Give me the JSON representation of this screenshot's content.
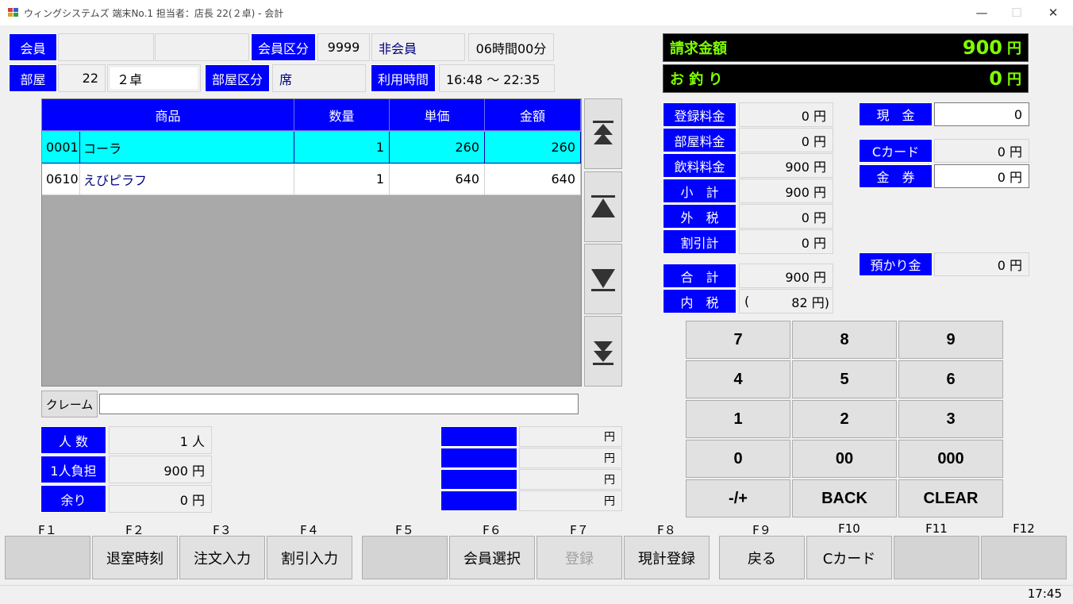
{
  "window": {
    "title": "ウィングシステムズ 端末No.1 担当者：店長 22(２卓) - 会計",
    "minimize": "—",
    "maximize": "☐",
    "close": "✕"
  },
  "member": {
    "label": "会員",
    "value1": "",
    "value2": "",
    "type_label": "会員区分",
    "type_code": "9999",
    "type_name": "非会員",
    "time_allowance": "06時間00分"
  },
  "room": {
    "label": "部屋",
    "number": "22",
    "name": "２卓",
    "type_label": "部屋区分",
    "type_name": "席",
    "usage_label": "利用時間",
    "usage_time": "16:48 ～ 22:35"
  },
  "grid": {
    "headers": [
      "商品",
      "数量",
      "単価",
      "金額"
    ],
    "rows": [
      {
        "code": "0001",
        "name": "コーラ",
        "qty": "1",
        "price": "260",
        "amount": "260",
        "selected": true
      },
      {
        "code": "0610",
        "name": "えびピラフ",
        "qty": "1",
        "price": "640",
        "amount": "640",
        "selected": false
      }
    ]
  },
  "claim": {
    "button": "クレーム",
    "value": ""
  },
  "people": {
    "count_label": "人 数",
    "count_value": "1 人",
    "per_person_label": "1人負担",
    "per_person_value": "900 円",
    "remainder_label": "余り",
    "remainder_value": "0 円"
  },
  "extra_lines": [
    {
      "label": "",
      "value": "円"
    },
    {
      "label": "",
      "value": "円"
    },
    {
      "label": "",
      "value": "円"
    },
    {
      "label": "",
      "value": "円"
    }
  ],
  "totals": {
    "billing_label": "請求金額",
    "billing_value": "900",
    "billing_unit": "円",
    "change_label": "お 釣 り",
    "change_value": "0",
    "change_unit": "円"
  },
  "breakdown": [
    {
      "label": "登録料金",
      "value": "0 円"
    },
    {
      "label": "部屋料金",
      "value": "0 円"
    },
    {
      "label": "飲料料金",
      "value": "900 円"
    },
    {
      "label": "小　計",
      "value": "900 円"
    },
    {
      "label": "外　税",
      "value": "0 円"
    },
    {
      "label": "割引計",
      "value": "0 円"
    }
  ],
  "sum": {
    "total_label": "合　計",
    "total_value": "900 円",
    "tax_label": "内　税",
    "tax_open": "(",
    "tax_value": "82 円)"
  },
  "payment": {
    "cash_label": "現　金",
    "cash_value": "0",
    "ccard_label": "Cカード",
    "ccard_value": "0 円",
    "voucher_label": "金　券",
    "voucher_value": "0 円",
    "deposit_label": "預かり金",
    "deposit_value": "0 円"
  },
  "keypad": [
    "7",
    "8",
    "9",
    "4",
    "5",
    "6",
    "1",
    "2",
    "3",
    "0",
    "00",
    "000",
    "-/+",
    "BACK",
    "CLEAR"
  ],
  "fkeys": [
    {
      "key": "F１",
      "label": ""
    },
    {
      "key": "F２",
      "label": "退室時刻"
    },
    {
      "key": "F３",
      "label": "注文入力"
    },
    {
      "key": "F４",
      "label": "割引入力"
    },
    {
      "key": "F５",
      "label": ""
    },
    {
      "key": "F６",
      "label": "会員選択"
    },
    {
      "key": "F７",
      "label": "登録"
    },
    {
      "key": "F８",
      "label": "現計登録"
    },
    {
      "key": "F９",
      "label": "戻る"
    },
    {
      "key": "F10",
      "label": "Cカード"
    },
    {
      "key": "F11",
      "label": ""
    },
    {
      "key": "F12",
      "label": ""
    }
  ],
  "status": {
    "clock": "17:45"
  },
  "colors": {
    "label_bg": "#0000ff",
    "selected_row": "#00ffff",
    "total_text": "#7fff00"
  },
  "icons": [
    "first-page-icon",
    "prev-page-icon",
    "next-page-icon",
    "last-page-icon"
  ]
}
